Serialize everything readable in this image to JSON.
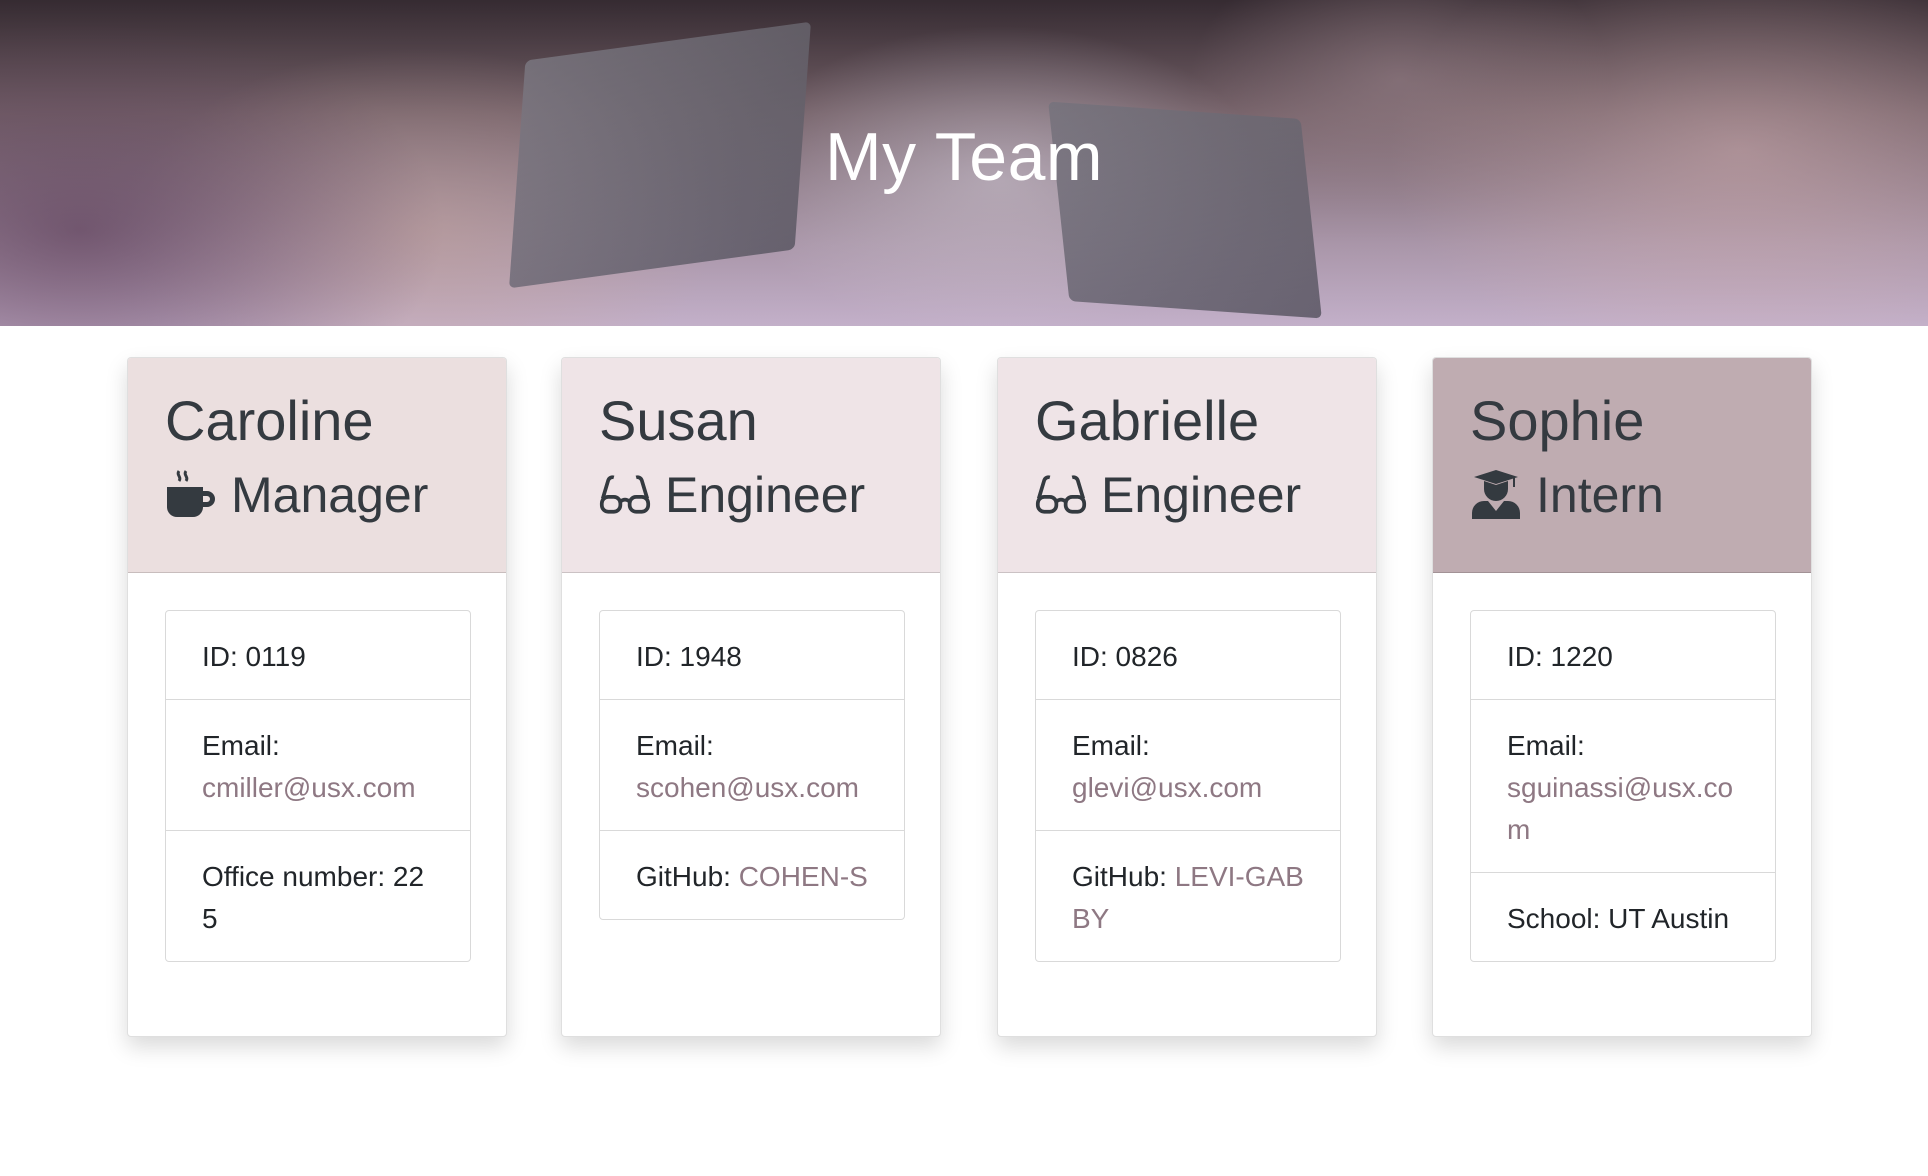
{
  "header": {
    "title": "My Team"
  },
  "colors": {
    "manager_header": "#ebdfdf",
    "engineer_header": "#efe4e7",
    "intern_header": "#bfacb1",
    "link": "#8e7883"
  },
  "team": [
    {
      "name": "Caroline",
      "role": "Manager",
      "role_icon": "coffee-mug-icon",
      "id_label": "ID: 0119",
      "email_label": "Email:",
      "email": "cmiller@usx.com",
      "extra_label": "Office number: 225",
      "extra_value": ""
    },
    {
      "name": "Susan",
      "role": "Engineer",
      "role_icon": "glasses-icon",
      "id_label": "ID: 1948",
      "email_label": "Email:",
      "email": "scohen@usx.com",
      "extra_label": "GitHub: ",
      "extra_value": "COHEN-S"
    },
    {
      "name": "Gabrielle",
      "role": "Engineer",
      "role_icon": "glasses-icon",
      "id_label": "ID: 0826",
      "email_label": "Email:",
      "email": "glevi@usx.com",
      "extra_label": "GitHub: ",
      "extra_value": "LEVI-GABBY"
    },
    {
      "name": "Sophie",
      "role": "Intern",
      "role_icon": "graduate-icon",
      "id_label": "ID: 1220",
      "email_label": "Email:",
      "email": "sguinassi@usx.com",
      "extra_label": "School: UT Austin",
      "extra_value": ""
    }
  ]
}
